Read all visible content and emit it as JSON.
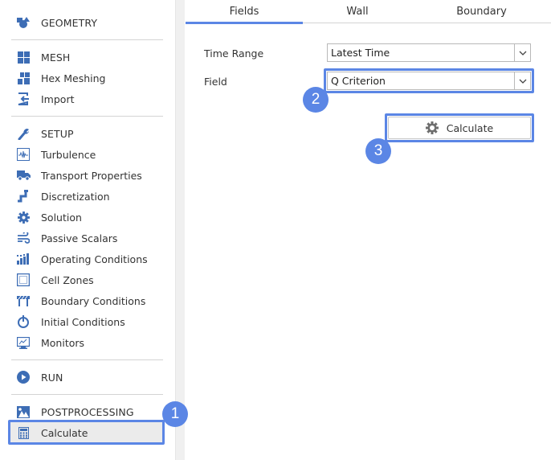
{
  "sidebar": {
    "items": [
      {
        "id": "geometry",
        "label": "GEOMETRY",
        "icon": "shapes-icon",
        "section": true
      },
      {
        "id": "mesh",
        "label": "MESH",
        "icon": "grid-icon",
        "section": true
      },
      {
        "id": "hex-meshing",
        "label": "Hex Meshing",
        "icon": "hex-mesh-icon"
      },
      {
        "id": "import",
        "label": "Import",
        "icon": "import-icon"
      },
      {
        "id": "setup",
        "label": "SETUP",
        "icon": "wrench-icon",
        "section": true
      },
      {
        "id": "turbulence",
        "label": "Turbulence",
        "icon": "waveform-icon"
      },
      {
        "id": "transport-properties",
        "label": "Transport Properties",
        "icon": "truck-icon"
      },
      {
        "id": "discretization",
        "label": "Discretization",
        "icon": "pipe-icon"
      },
      {
        "id": "solution",
        "label": "Solution",
        "icon": "gear-icon"
      },
      {
        "id": "passive-scalars",
        "label": "Passive Scalars",
        "icon": "wind-icon"
      },
      {
        "id": "operating-conditions",
        "label": "Operating Conditions",
        "icon": "bar-chart-icon"
      },
      {
        "id": "cell-zones",
        "label": "Cell Zones",
        "icon": "dotted-square-icon"
      },
      {
        "id": "boundary-conditions",
        "label": "Boundary Conditions",
        "icon": "barrier-icon"
      },
      {
        "id": "initial-conditions",
        "label": "Initial Conditions",
        "icon": "power-icon"
      },
      {
        "id": "monitors",
        "label": "Monitors",
        "icon": "monitor-icon"
      },
      {
        "id": "run",
        "label": "RUN",
        "icon": "play-icon",
        "section": true
      },
      {
        "id": "postprocessing",
        "label": "POSTPROCESSING",
        "icon": "image-icon",
        "section": true
      },
      {
        "id": "calculate",
        "label": "Calculate",
        "icon": "calculator-icon",
        "active": true
      }
    ]
  },
  "tabs": [
    {
      "label": "Fields",
      "active": true
    },
    {
      "label": "Wall",
      "active": false
    },
    {
      "label": "Boundary",
      "active": false
    }
  ],
  "form": {
    "time_range": {
      "label": "Time Range",
      "value": "Latest Time"
    },
    "field": {
      "label": "Field",
      "value": "Q Criterion"
    },
    "calculate_button": {
      "label": "Calculate",
      "icon": "gear-icon"
    }
  },
  "annotations": {
    "step1": "1",
    "step2": "2",
    "step3": "3"
  },
  "colors": {
    "accent": "#5b86e5",
    "icon": "#3d6db5",
    "active_bg": "#ebebeb"
  }
}
